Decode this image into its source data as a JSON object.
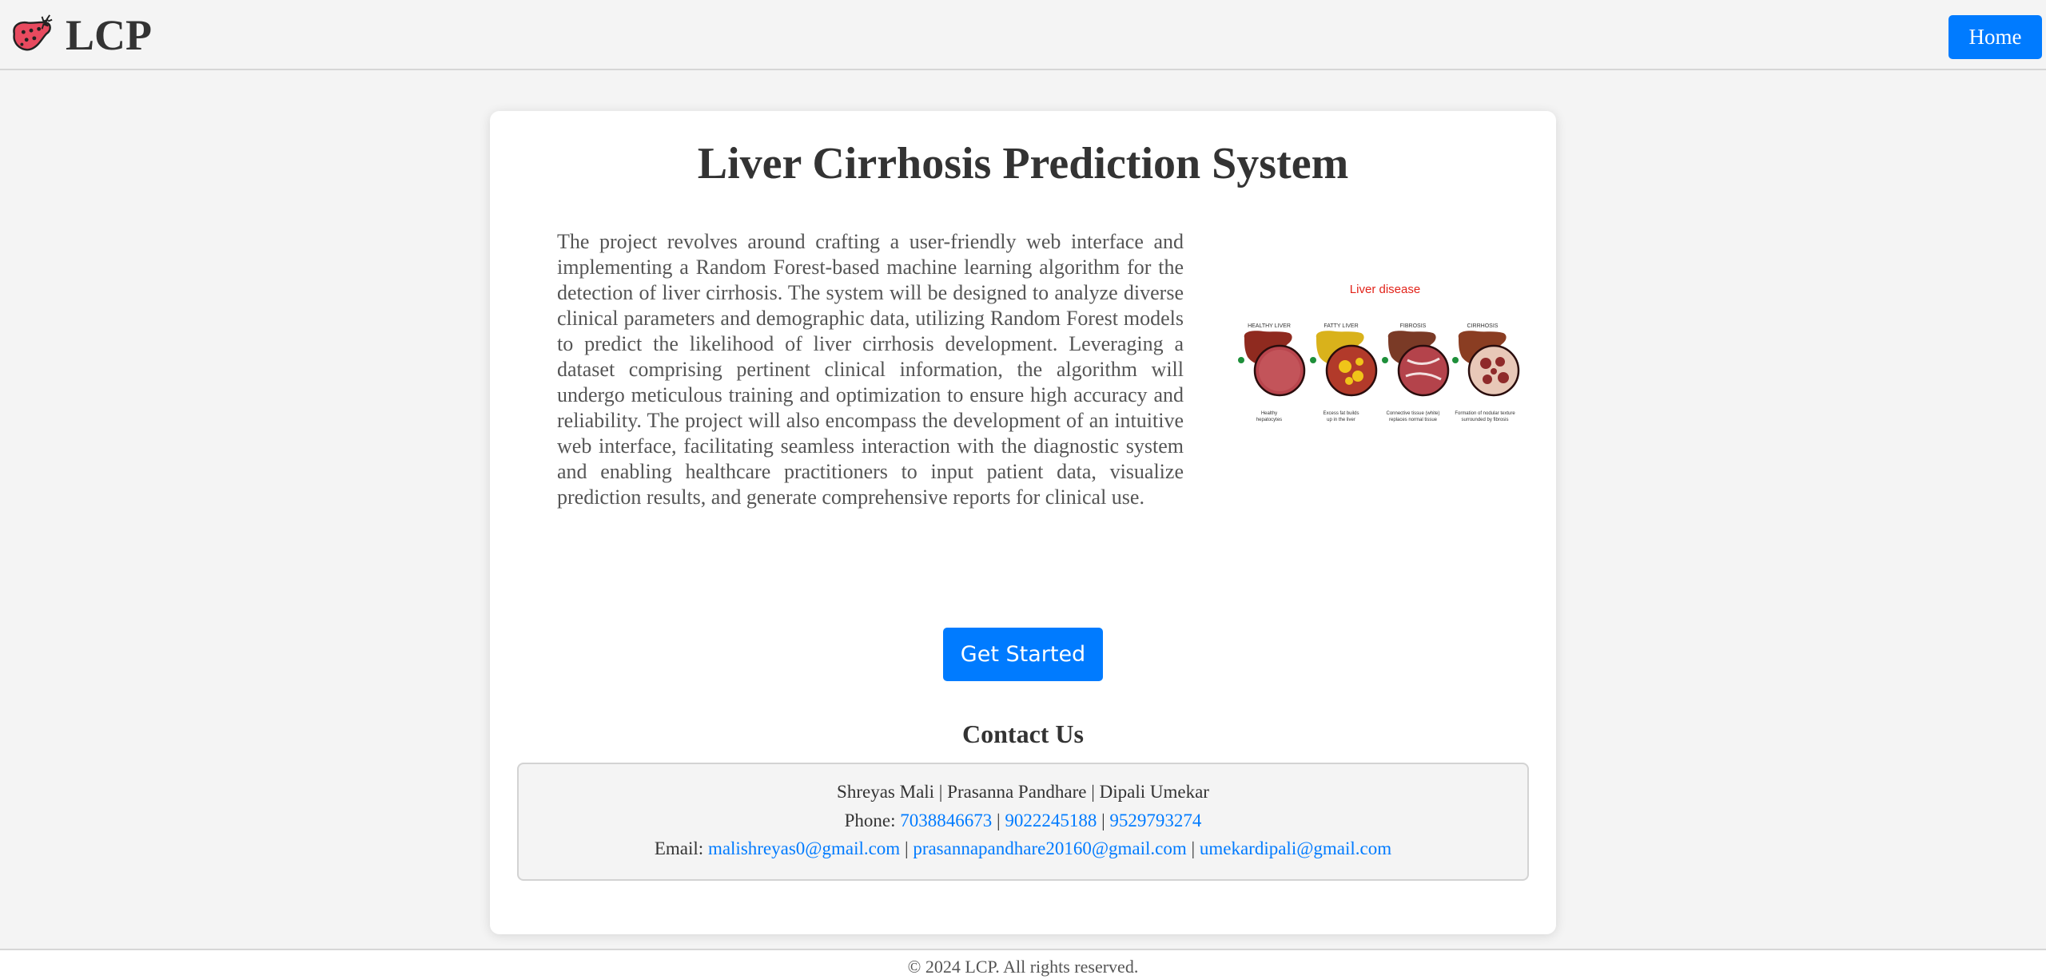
{
  "header": {
    "brand": "LCP",
    "logo_icon": "liver-icon",
    "home_label": "Home"
  },
  "main": {
    "title": "Liver Cirrhosis Prediction System",
    "description": "The project revolves around crafting a user-friendly web interface and implementing a Random Forest-based machine learning algorithm for the detection of liver cirrhosis. The system will be designed to analyze diverse clinical parameters and demographic data, utilizing Random Forest models to predict the likelihood of liver cirrhosis development. Leveraging a dataset comprising pertinent clinical information, the algorithm will undergo meticulous training and optimization to ensure high accuracy and reliability. The project will also encompass the development of an intuitive web interface, facilitating seamless interaction with the diagnostic system and enabling healthcare practitioners to input patient data, visualize prediction results, and generate comprehensive reports for clinical use.",
    "illustration": {
      "title": "Liver disease",
      "stages": [
        {
          "label": "HEALTHY LIVER",
          "caption1": "Healthy",
          "caption2": "hepatocytes"
        },
        {
          "label": "FATTY LIVER",
          "caption1": "Excess fat builds",
          "caption2": "up in the liver"
        },
        {
          "label": "FIBROSIS",
          "caption1": "Connective tissue (white)",
          "caption2": "replaces normal tissue"
        },
        {
          "label": "CIRRHOSIS",
          "caption1": "Formation of nodular texture",
          "caption2": "surrounded by fibrosis"
        }
      ]
    },
    "get_started_label": "Get Started"
  },
  "contact": {
    "title": "Contact Us",
    "names": "Shreyas Mali | Prasanna Pandhare | Dipali Umekar",
    "phone_label": "Phone:",
    "phones": [
      "7038846673",
      "9022245188",
      "9529793274"
    ],
    "email_label": "Email:",
    "emails": [
      "malishreyas0@gmail.com",
      "prasannapandhare20160@gmail.com",
      "umekardipali@gmail.com"
    ],
    "separator": "|"
  },
  "footer": {
    "text": "© 2024 LCP. All rights reserved."
  },
  "colors": {
    "accent": "#007bff",
    "background": "#f4f4f4",
    "text": "#333333"
  }
}
